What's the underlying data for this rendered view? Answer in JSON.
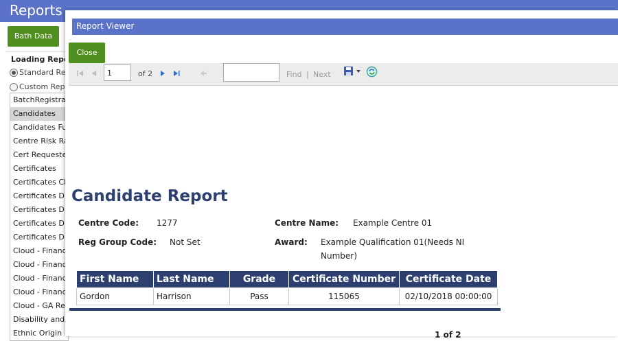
{
  "app": {
    "title": "Reports",
    "bath_button": "Bath Data",
    "loading_label": "Loading Report",
    "radio_standard": "Standard Rep",
    "radio_custom": "Custom Repo",
    "report_items": [
      "BatchRegistra",
      "Candidates",
      "Candidates Fu",
      "Centre Risk Ra",
      "Cert Requeste",
      "Certificates",
      "Certificates Cl",
      "Certificates D",
      "Certificates D",
      "Certificates D",
      "Certificates D",
      "Cloud - Financ",
      "Cloud - Financ",
      "Cloud - Financ",
      "Cloud - Financ",
      "Cloud - GA Re",
      "Disability and",
      "Ethnic Origin"
    ],
    "selected_index": 1
  },
  "viewer": {
    "title": "Report Viewer",
    "close_label": "Close",
    "page_value": "1",
    "page_total": "of 2",
    "find_label": "Find",
    "separator": "|",
    "next_label": "Next"
  },
  "report": {
    "title": "Candidate Report",
    "centre_code_label": "Centre Code:",
    "centre_code": "1277",
    "centre_name_label": "Centre Name:",
    "centre_name": "Example Centre 01",
    "reg_group_label": "Reg Group Code:",
    "reg_group": "Not Set",
    "award_label": "Award:",
    "award_line1": "Example Qualification 01(Needs NI",
    "award_line2": "Number)",
    "columns": [
      "First Name",
      "Last Name",
      "Grade",
      "Certificate Number",
      "Certificate Date"
    ],
    "rows": [
      [
        "Gordon",
        "Harrison",
        "Pass",
        "115065",
        "02/10/2018 00:00:00"
      ]
    ],
    "page_footer": "1 of 2"
  },
  "colors": {
    "header_blue": "#5a72c8",
    "button_green": "#4f8f1f",
    "report_navy": "#2c3f6e"
  }
}
